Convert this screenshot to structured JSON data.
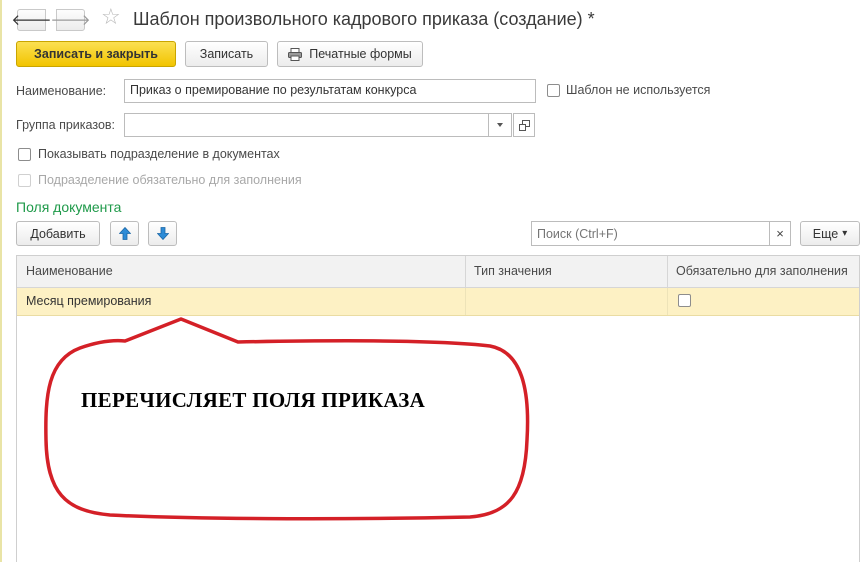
{
  "window": {
    "title": "Шаблон произвольного кадрового приказа (создание) *",
    "back_glyph": "🡐",
    "forward_glyph": "🡒",
    "star_glyph": "☆"
  },
  "toolbar": {
    "save_close_label": "Записать и закрыть",
    "save_label": "Записать",
    "print_label": "Печатные формы"
  },
  "form": {
    "name_label": "Наименование:",
    "name_value": "Приказ о премирование по результатам конкурса",
    "unused_label": "Шаблон не используется",
    "group_label": "Группа приказов:",
    "group_value": "",
    "show_dept_label": "Показывать подразделение в документах",
    "dept_required_label": "Подразделение обязательно для заполнения"
  },
  "fields_section": {
    "title": "Поля документа",
    "add_label": "Добавить",
    "search_placeholder": "Поиск (Ctrl+F)",
    "clear_glyph": "×",
    "more_label": "Еще",
    "more_arrow": "▾"
  },
  "table": {
    "headers": [
      "Наименование",
      "Тип значения",
      "Обязательно для заполнения"
    ],
    "rows": [
      {
        "name": "Месяц премирования",
        "type": "",
        "required": false
      }
    ]
  },
  "annotation": {
    "text": "ПЕРЕЧИСЛЯЕТ ПОЛЯ ПРИКАЗА",
    "color": "#d42027"
  },
  "colors": {
    "primary_button": "#f2c400",
    "section_title": "#1f9a4a",
    "selected_row": "#fdf1c4",
    "arrow_blue": "#2d8bd6"
  }
}
